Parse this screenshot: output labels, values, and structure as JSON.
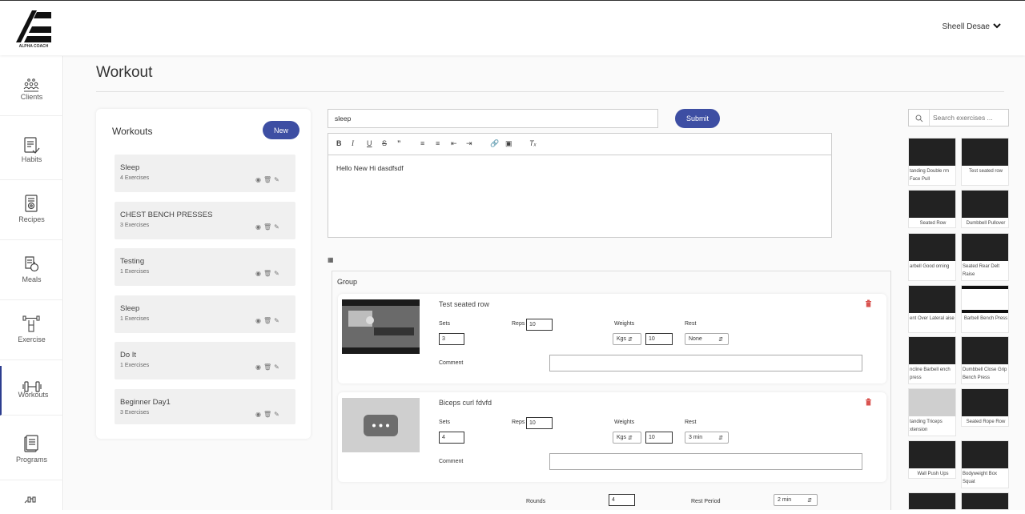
{
  "header": {
    "logo_text": "ALPHA COACH",
    "user_name": "Sheell Desae"
  },
  "sidebar": {
    "items": [
      {
        "label": "Clients",
        "icon": "clients-icon"
      },
      {
        "label": "Habits",
        "icon": "habits-icon"
      },
      {
        "label": "Recipes",
        "icon": "recipes-icon"
      },
      {
        "label": "Meals",
        "icon": "meals-icon"
      },
      {
        "label": "Exercise",
        "icon": "exercise-icon"
      },
      {
        "label": "Workouts",
        "icon": "workouts-icon",
        "active": true
      },
      {
        "label": "Programs",
        "icon": "programs-icon"
      }
    ]
  },
  "page": {
    "title": "Workout"
  },
  "workouts": {
    "title": "Workouts",
    "new_label": "New",
    "items": [
      {
        "name": "Sleep",
        "exercises": "4 Exercises"
      },
      {
        "name": "CHEST BENCH PRESSES",
        "exercises": "3 Exercises"
      },
      {
        "name": "Testing",
        "exercises": "1 Exercises"
      },
      {
        "name": "Sleep",
        "exercises": "1 Exercises"
      },
      {
        "name": "Do It",
        "exercises": "1 Exercises"
      },
      {
        "name": "Beginner Day1",
        "exercises": "3 Exercises"
      }
    ]
  },
  "form": {
    "name_value": "sleep",
    "submit_label": "Submit",
    "editor_text": "Hello New Hi dasdfsdf"
  },
  "group": {
    "label": "Group",
    "exercises": [
      {
        "name": "Test seated row",
        "sets_label": "Sets",
        "sets": "3",
        "reps_label": "Reps",
        "reps": "10",
        "weights_label": "Weights",
        "weight_unit": "Kgs",
        "weight": "10",
        "rest_label": "Rest",
        "rest": "None",
        "comment_label": "Comment"
      },
      {
        "name": "Biceps curl fdvfd",
        "sets_label": "Sets",
        "sets": "4",
        "reps_label": "Reps",
        "reps": "10",
        "weights_label": "Weights",
        "weight_unit": "Kgs",
        "weight": "10",
        "rest_label": "Rest",
        "rest": "3 min",
        "comment_label": "Comment"
      }
    ],
    "rounds_label": "Rounds",
    "rounds": "4",
    "rest_period_label": "Rest Period",
    "rest_period": "2 min"
  },
  "library": {
    "search_placeholder": "Search exercises ...",
    "items": [
      {
        "name": "tanding Double rm Face Pull"
      },
      {
        "name": "Test seated row"
      },
      {
        "name": "Seated Row"
      },
      {
        "name": "Dumbbell Pullover"
      },
      {
        "name": "arbell Good orning"
      },
      {
        "name": "Seated Rear Delt Raise"
      },
      {
        "name": "ent Over Lateral aise"
      },
      {
        "name": "Barbell Bench Press"
      },
      {
        "name": "ncline Barbell ench press"
      },
      {
        "name": "Dumbbell Close Grip Bench Press"
      },
      {
        "name": "tanding Triceps xtension"
      },
      {
        "name": "Seated Rope Row"
      },
      {
        "name": "Wall Push Ups"
      },
      {
        "name": "Bodyweight Box Squat"
      }
    ]
  }
}
